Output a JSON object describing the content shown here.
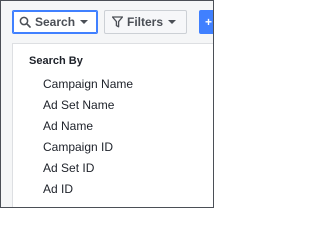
{
  "toolbar": {
    "search_label": "Search",
    "search_icon": "magnifier",
    "filters_label": "Filters",
    "filters_icon": "funnel",
    "add_label": "+",
    "accent_color": "#4080ff"
  },
  "search_menu": {
    "header": "Search By",
    "items": [
      {
        "label": "Campaign Name"
      },
      {
        "label": "Ad Set Name"
      },
      {
        "label": "Ad Name"
      },
      {
        "label": "Campaign ID"
      },
      {
        "label": "Ad Set ID"
      },
      {
        "label": "Ad ID"
      }
    ]
  }
}
